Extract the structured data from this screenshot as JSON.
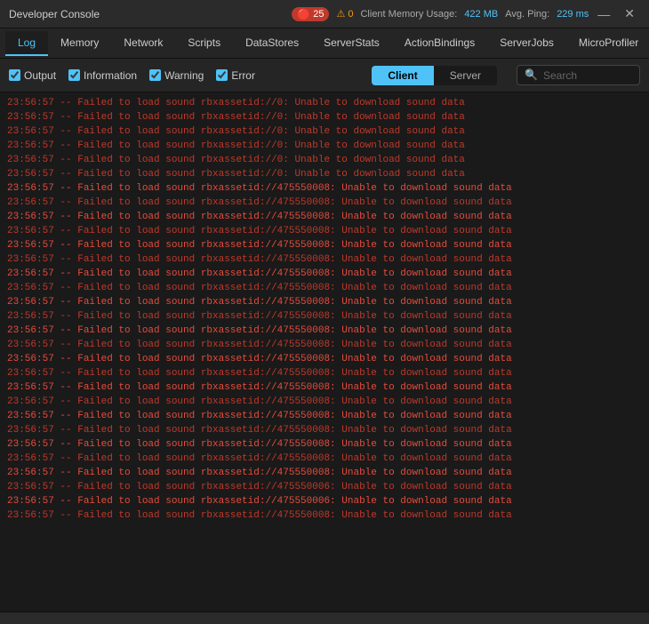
{
  "titleBar": {
    "title": "Developer Console",
    "errorCount": "25",
    "warningCount": "0",
    "memoryLabel": "Client Memory Usage:",
    "memoryValue": "422 MB",
    "pingLabel": "Avg. Ping:",
    "pingValue": "229 ms",
    "minimizeBtn": "—",
    "closeBtn": "✕"
  },
  "navTabs": [
    {
      "label": "Log",
      "active": true
    },
    {
      "label": "Memory",
      "active": false
    },
    {
      "label": "Network",
      "active": false
    },
    {
      "label": "Scripts",
      "active": false
    },
    {
      "label": "DataStores",
      "active": false
    },
    {
      "label": "ServerStats",
      "active": false
    },
    {
      "label": "ActionBindings",
      "active": false
    },
    {
      "label": "ServerJobs",
      "active": false
    },
    {
      "label": "MicroProfiler",
      "active": false
    }
  ],
  "filterBar": {
    "output": {
      "label": "Output",
      "checked": true
    },
    "information": {
      "label": "Information",
      "checked": true
    },
    "warning": {
      "label": "Warning",
      "checked": true
    },
    "error": {
      "label": "Error",
      "checked": true
    },
    "clientBtn": "Client",
    "serverBtn": "Server",
    "searchPlaceholder": "Search"
  },
  "logLines": [
    "23:56:57  --  Failed to load sound rbxassetid://0: Unable to download sound data",
    "23:56:57  --  Failed to load sound rbxassetid://0: Unable to download sound data",
    "23:56:57  --  Failed to load sound rbxassetid://0: Unable to download sound data",
    "23:56:57  --  Failed to load sound rbxassetid://0: Unable to download sound data",
    "23:56:57  --  Failed to load sound rbxassetid://0: Unable to download sound data",
    "23:56:57  --  Failed to load sound rbxassetid://0: Unable to download sound data",
    "23:56:57  --  Failed to load sound rbxassetid://475550008: Unable to download sound data",
    "23:56:57  --  Failed to load sound rbxassetid://475550008: Unable to download sound data",
    "23:56:57  --  Failed to load sound rbxassetid://475550008: Unable to download sound data",
    "23:56:57  --  Failed to load sound rbxassetid://475550008: Unable to download sound data",
    "23:56:57  --  Failed to load sound rbxassetid://475550008: Unable to download sound data",
    "23:56:57  --  Failed to load sound rbxassetid://475550008: Unable to download sound data",
    "23:56:57  --  Failed to load sound rbxassetid://475550008: Unable to download sound data",
    "23:56:57  --  Failed to load sound rbxassetid://475550008: Unable to download sound data",
    "23:56:57  --  Failed to load sound rbxassetid://475550008: Unable to download sound data",
    "23:56:57  --  Failed to load sound rbxassetid://475550008: Unable to download sound data",
    "23:56:57  --  Failed to load sound rbxassetid://475550008: Unable to download sound data",
    "23:56:57  --  Failed to load sound rbxassetid://475550008: Unable to download sound data",
    "23:56:57  --  Failed to load sound rbxassetid://475550008: Unable to download sound data",
    "23:56:57  --  Failed to load sound rbxassetid://475550008: Unable to download sound data",
    "23:56:57  --  Failed to load sound rbxassetid://475550008: Unable to download sound data",
    "23:56:57  --  Failed to load sound rbxassetid://475550008: Unable to download sound data",
    "23:56:57  --  Failed to load sound rbxassetid://475550008: Unable to download sound data",
    "23:56:57  --  Failed to load sound rbxassetid://475550008: Unable to download sound data",
    "23:56:57  --  Failed to load sound rbxassetid://475550008: Unable to download sound data",
    "23:56:57  --  Failed to load sound rbxassetid://475550008: Unable to download sound data",
    "23:56:57  --  Failed to load sound rbxassetid://475550008: Unable to download sound data",
    "23:56:57  --  Failed to load sound rbxassetid://475550006: Unable to download sound data",
    "23:56:57  --  Failed to load sound rbxassetid://475550006: Unable to download sound data",
    "23:56:57  --  Failed to load sound rbxassetid://475550008: Unable to download sound data"
  ]
}
